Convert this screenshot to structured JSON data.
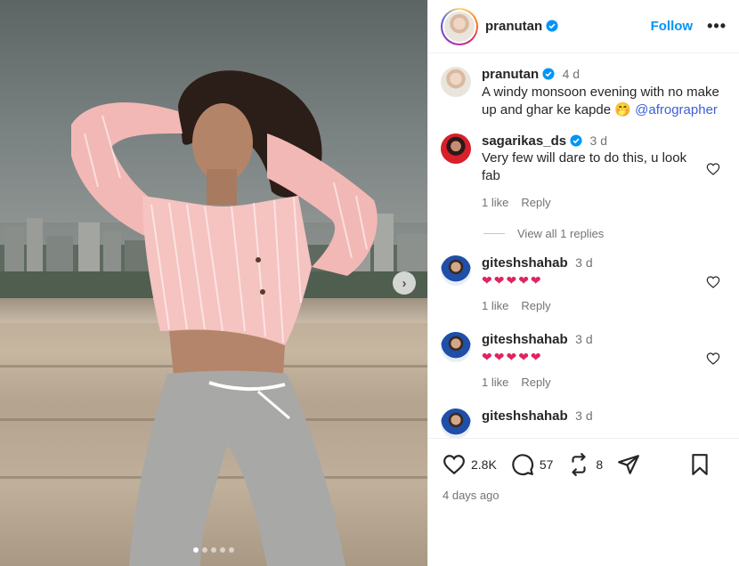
{
  "post": {
    "author": "pranutan",
    "follow_label": "Follow",
    "more_label": "•••",
    "caption": {
      "author": "pranutan",
      "time": "4 d",
      "text": "A windy monsoon evening with no make up and ghar ke kapde 🤭 ",
      "mention": "@afrographer"
    },
    "carousel_next": "›",
    "carousel_dots": 5
  },
  "comments": [
    {
      "author": "sagarikas_ds",
      "verified": true,
      "time": "3 d",
      "text": "Very few will dare to do this, u look fab",
      "likes_label": "1 like",
      "reply_label": "Reply",
      "view_replies_label": "View all 1 replies"
    },
    {
      "author": "giteshshahab",
      "time": "3 d",
      "text": "❤❤❤❤❤",
      "likes_label": "1 like",
      "reply_label": "Reply"
    },
    {
      "author": "giteshshahab",
      "time": "3 d",
      "text": "❤❤❤❤❤",
      "likes_label": "1 like",
      "reply_label": "Reply"
    },
    {
      "author": "giteshshahab",
      "time": "3 d",
      "text": ""
    }
  ],
  "actions": {
    "like_count": "2.8K",
    "comment_count": "57",
    "repost_count": "8",
    "posted_ago": "4 days ago"
  },
  "colors": {
    "accent": "#0095f6",
    "verified": "#0095f6",
    "heart": "#e0245e",
    "muted": "#737373"
  },
  "icons": [
    "verified-badge-icon",
    "more-icon",
    "heart-icon",
    "comment-icon",
    "repost-icon",
    "share-icon",
    "bookmark-icon",
    "chevron-right-icon"
  ]
}
